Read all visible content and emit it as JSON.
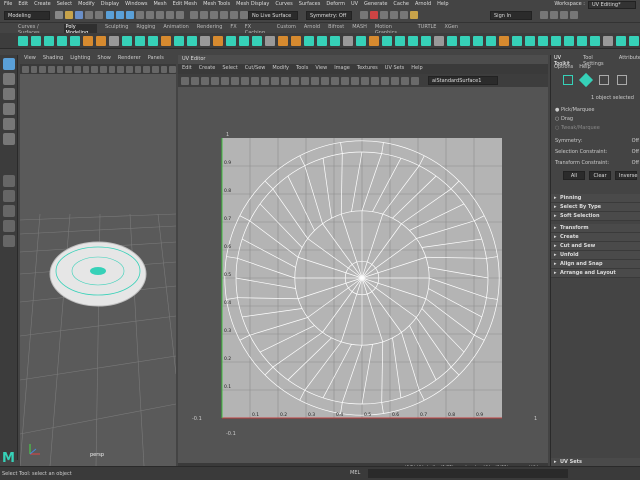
{
  "menubar": {
    "items": [
      "File",
      "Edit",
      "Create",
      "Select",
      "Modify",
      "Display",
      "Windows",
      "Mesh",
      "Edit Mesh",
      "Mesh Tools",
      "Mesh Display",
      "Curves",
      "Surfaces",
      "Deform",
      "UV",
      "Generate",
      "Cache",
      "Arnold",
      "Help"
    ],
    "workspace_label": "Workspace :",
    "workspace_value": "UV Editing*"
  },
  "statusline": {
    "mode": "Modeling",
    "live_surface": "No Live Surface",
    "symmetry": "Symmetry: Off",
    "sign_in": "Sign In"
  },
  "shelf": {
    "tabs": [
      "Curves / Surfaces",
      "Poly Modeling",
      "Sculpting",
      "Rigging",
      "Animation",
      "Rendering",
      "FX",
      "FX Caching",
      "Custom",
      "Arnold",
      "Bifrost",
      "MASH",
      "Motion Graphics",
      "TURTLE",
      "XGen"
    ],
    "active_tab": "Poly Modeling"
  },
  "viewport": {
    "menu": [
      "View",
      "Shading",
      "Lighting",
      "Show",
      "Renderer",
      "Panels"
    ],
    "camera_label": "persp"
  },
  "uv_editor": {
    "title": "UV Editor",
    "menu": [
      "Edit",
      "Create",
      "Select",
      "Cut/Sew",
      "Modify",
      "Tools",
      "View",
      "Image",
      "Textures",
      "UV Sets",
      "Help"
    ],
    "texture_name": "aiStandardSurface1",
    "x_ticks": [
      "0.1",
      "0.2",
      "0.3",
      "0.4",
      "0.5",
      "0.6",
      "0.7",
      "0.8",
      "0.9"
    ],
    "y_ticks": [
      "0.9",
      "0.8",
      "0.7",
      "0.6",
      "0.5",
      "0.4",
      "0.3",
      "0.2",
      "0.1"
    ],
    "outside_ticks": {
      "top": "1",
      "bottom": "-0.1",
      "left": "-0.1",
      "right": "1"
    },
    "stats": "(0/1) UV shells, (0/62) overlapping UVs, (0/81) reversed UVs"
  },
  "uv_toolkit": {
    "tabs": [
      "UV Toolkit",
      "Tool Settings",
      "Attribute"
    ],
    "menu": [
      "Options",
      "Help"
    ],
    "selection_info": "1 object selected",
    "pick_modes": [
      "Pick/Marquee",
      "Drag",
      "Tweak/Marquee"
    ],
    "symmetry_label": "Symmetry:",
    "symmetry_value": "Off",
    "selection_constraint_label": "Selection Constraint:",
    "selection_constraint_value": "Off",
    "transform_constraint_label": "Transform Constraint:",
    "transform_constraint_value": "Off",
    "buttons": [
      "All",
      "Clear",
      "Inverse"
    ],
    "sections": [
      "Pinning",
      "Select By Type",
      "Soft Selection",
      "Transform",
      "Create",
      "Cut and Sew",
      "Unfold",
      "Align and Snap",
      "Arrange and Layout"
    ],
    "footer_section": "UV Sets"
  },
  "cmdline": {
    "lang": "MEL",
    "help": "Select Tool: select an object"
  },
  "colors": {
    "accent_teal": "#36d1b8",
    "accent_orange": "#d68a2f",
    "uv_grid_bg": "#b4b4b4",
    "uv_lines": "#ffffff"
  }
}
